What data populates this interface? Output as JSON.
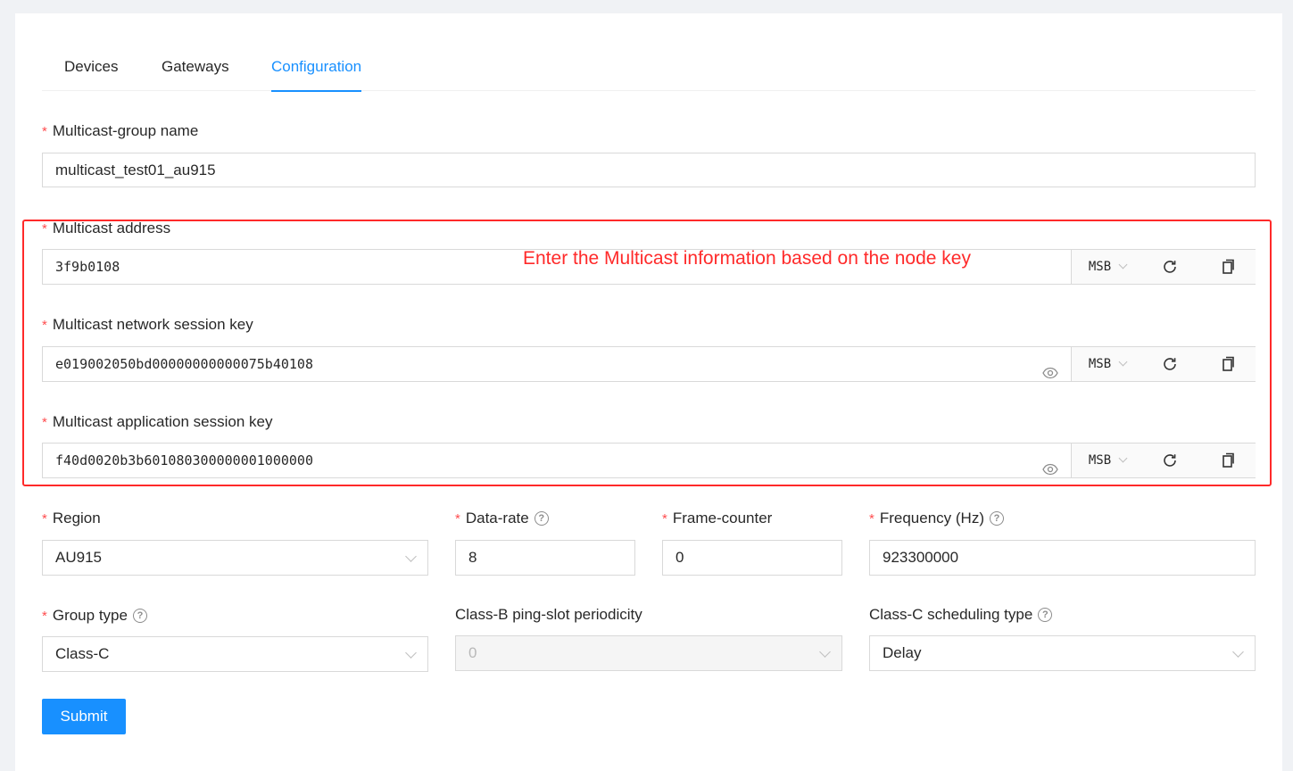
{
  "tabs": [
    {
      "label": "Devices",
      "active": false
    },
    {
      "label": "Gateways",
      "active": false
    },
    {
      "label": "Configuration",
      "active": true
    }
  ],
  "form": {
    "group_name": {
      "label": "Multicast-group name",
      "value": "multicast_test01_au915",
      "required": true
    },
    "address": {
      "label": "Multicast address",
      "value": "3f9b0108",
      "byte_order": "MSB",
      "required": true
    },
    "nwk_key": {
      "label": "Multicast network session key",
      "value": "e019002050bd00000000000075b40108",
      "byte_order": "MSB",
      "required": true
    },
    "app_key": {
      "label": "Multicast application session key",
      "value": "f40d0020b3b60108030000000100000 0",
      "byte_order": "MSB",
      "required": true
    },
    "region": {
      "label": "Region",
      "value": "AU915",
      "required": true
    },
    "data_rate": {
      "label": "Data-rate",
      "value": "8",
      "required": true
    },
    "frame_counter": {
      "label": "Frame-counter",
      "value": "0",
      "required": true
    },
    "frequency": {
      "label": "Frequency (Hz)",
      "value": "923300000",
      "required": true
    },
    "group_type": {
      "label": "Group type",
      "value": "Class-C",
      "required": true
    },
    "ping_slot": {
      "label": "Class-B ping-slot periodicity",
      "value": "0",
      "disabled": true
    },
    "scheduling": {
      "label": "Class-C scheduling type",
      "value": "Delay"
    },
    "submit_label": "Submit"
  },
  "annotation": {
    "text": "Enter the Multicast information based on the node key",
    "color": "#ff2a2a"
  },
  "colors": {
    "accent": "#1890ff",
    "required": "#ff4d4f"
  }
}
